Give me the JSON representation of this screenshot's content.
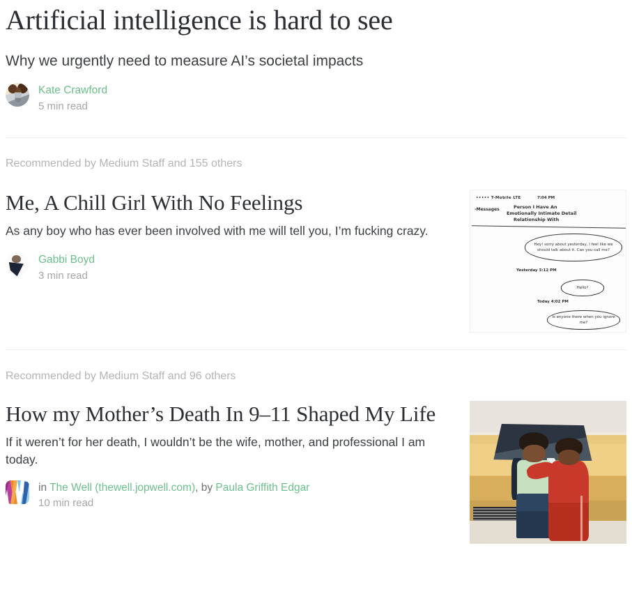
{
  "colors": {
    "link_green": "#6cc08b",
    "title_dark": "#2b2e33",
    "meta_gray": "#b5b5b5",
    "read_time_gray": "#a6a6a6",
    "divider": "#ececec"
  },
  "hero": {
    "title": "Artificial intelligence is hard to see",
    "subtitle": "Why we urgently need to measure AI’s societal impacts",
    "author": "Kate Crawford",
    "read_time": "5 min read",
    "avatar_icon": "author-avatar-photo"
  },
  "recommendations": [
    {
      "meta": "Recommended by Medium Staff and 155 others",
      "title": "Me, A Chill Girl With No Feelings",
      "excerpt": "As any boy who has ever been involved with me will tell you, I’m fucking crazy.",
      "author": "Gabbi Boyd",
      "read_time": "3 min read",
      "avatar_icon": "author-avatar-photo",
      "thumbnail": {
        "kind": "handwritten-note-sketch",
        "status_bar_carrier": "••••• T-Mobile LTE",
        "status_bar_time": "7:04 PM",
        "back_label": "‹Messages",
        "header_line1": "Person I Have An",
        "header_line2": "Emotionally Intimate Detail",
        "header_line3": "Relationship With",
        "bubble1": "Hey! sorry about yesterday, I feel like we should talk about it. Can you call me?",
        "timestamp1": "Yesterday  3:12 PM",
        "bubble2": "Hello?",
        "timestamp2": "Today  4:02 PM",
        "bubble3": "Is anyone there when you ignore me?"
      }
    },
    {
      "meta": "Recommended by Medium Staff and 96 others",
      "title": "How my Mother’s Death In 9–11 Shaped My Life",
      "excerpt": "If it weren’t for her death, I wouldn’t be the wife, mother, and professional I am today.",
      "publication_prefix": "in ",
      "publication": "The Well (thewell.jopwell.com)",
      "byline_connector": ", by ",
      "author": "Paula Griffith Edgar",
      "read_time": "10 min read",
      "logo_icon": "the-well-publication-logo",
      "thumbnail": {
        "kind": "vintage-family-photo",
        "description": "Woman in light green top and blue jeans with child in red tracksuit in front of a yellow car"
      }
    }
  ]
}
